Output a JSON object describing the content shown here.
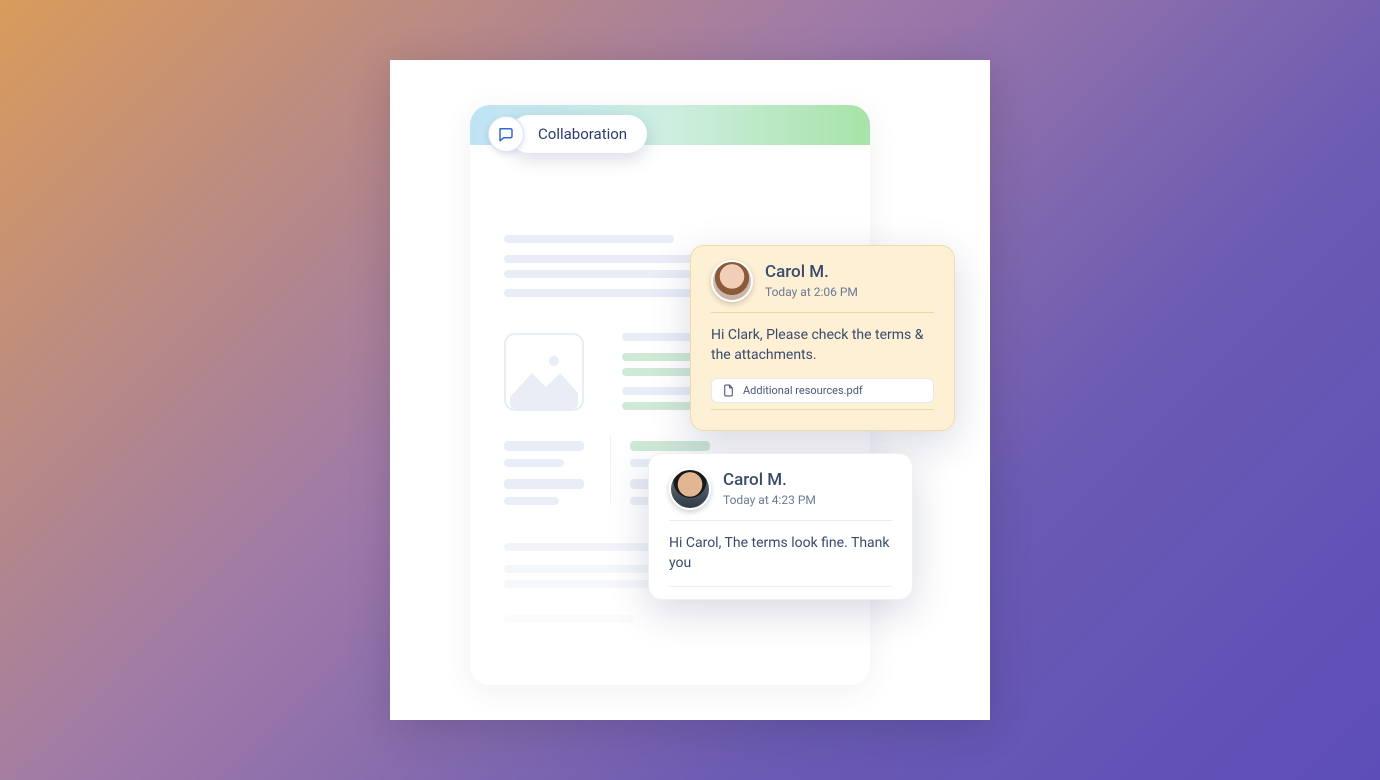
{
  "chip": {
    "label": "Collaboration",
    "icon": "chat-icon"
  },
  "comments": [
    {
      "author": "Carol M.",
      "time": "Today at 2:06 PM",
      "body": "Hi Clark, Please check the terms & the attachments.",
      "attachment": "Additional resources.pdf"
    },
    {
      "author": "Carol M.",
      "time": "Today at 4:23 PM",
      "body": "Hi Carol, The terms look fine. Thank you"
    }
  ],
  "colors": {
    "highlight_bg": "#fdf0d5",
    "highlight_border": "#f0dca8",
    "text_primary": "#3a4a6b",
    "text_secondary": "#6b7a94"
  }
}
